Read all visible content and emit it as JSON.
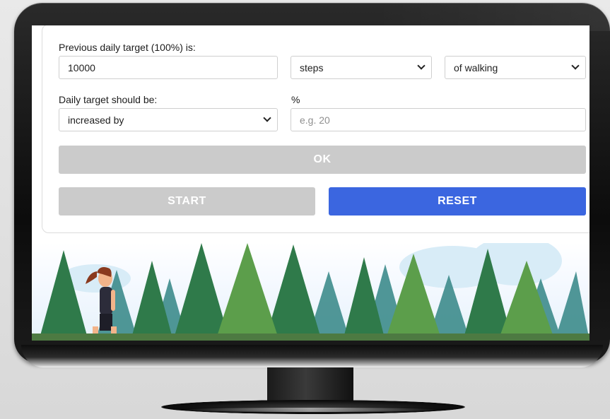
{
  "form": {
    "previous_label": "Previous daily target (100%) is:",
    "previous_value": "10000",
    "unit_select": "steps",
    "activity_select": "of walking",
    "target_label": "Daily target should be:",
    "percent_label": "%",
    "direction_select": "increased by",
    "percent_placeholder": "e.g. 20",
    "ok_label": "OK",
    "start_label": "START",
    "reset_label": "RESET"
  },
  "colors": {
    "primary": "#3b66e0",
    "disabled": "#cbcbcb"
  },
  "icons": {
    "select_arrow": "chevron-down-icon"
  },
  "illustration": {
    "subject": "woman-walking-in-forest"
  }
}
